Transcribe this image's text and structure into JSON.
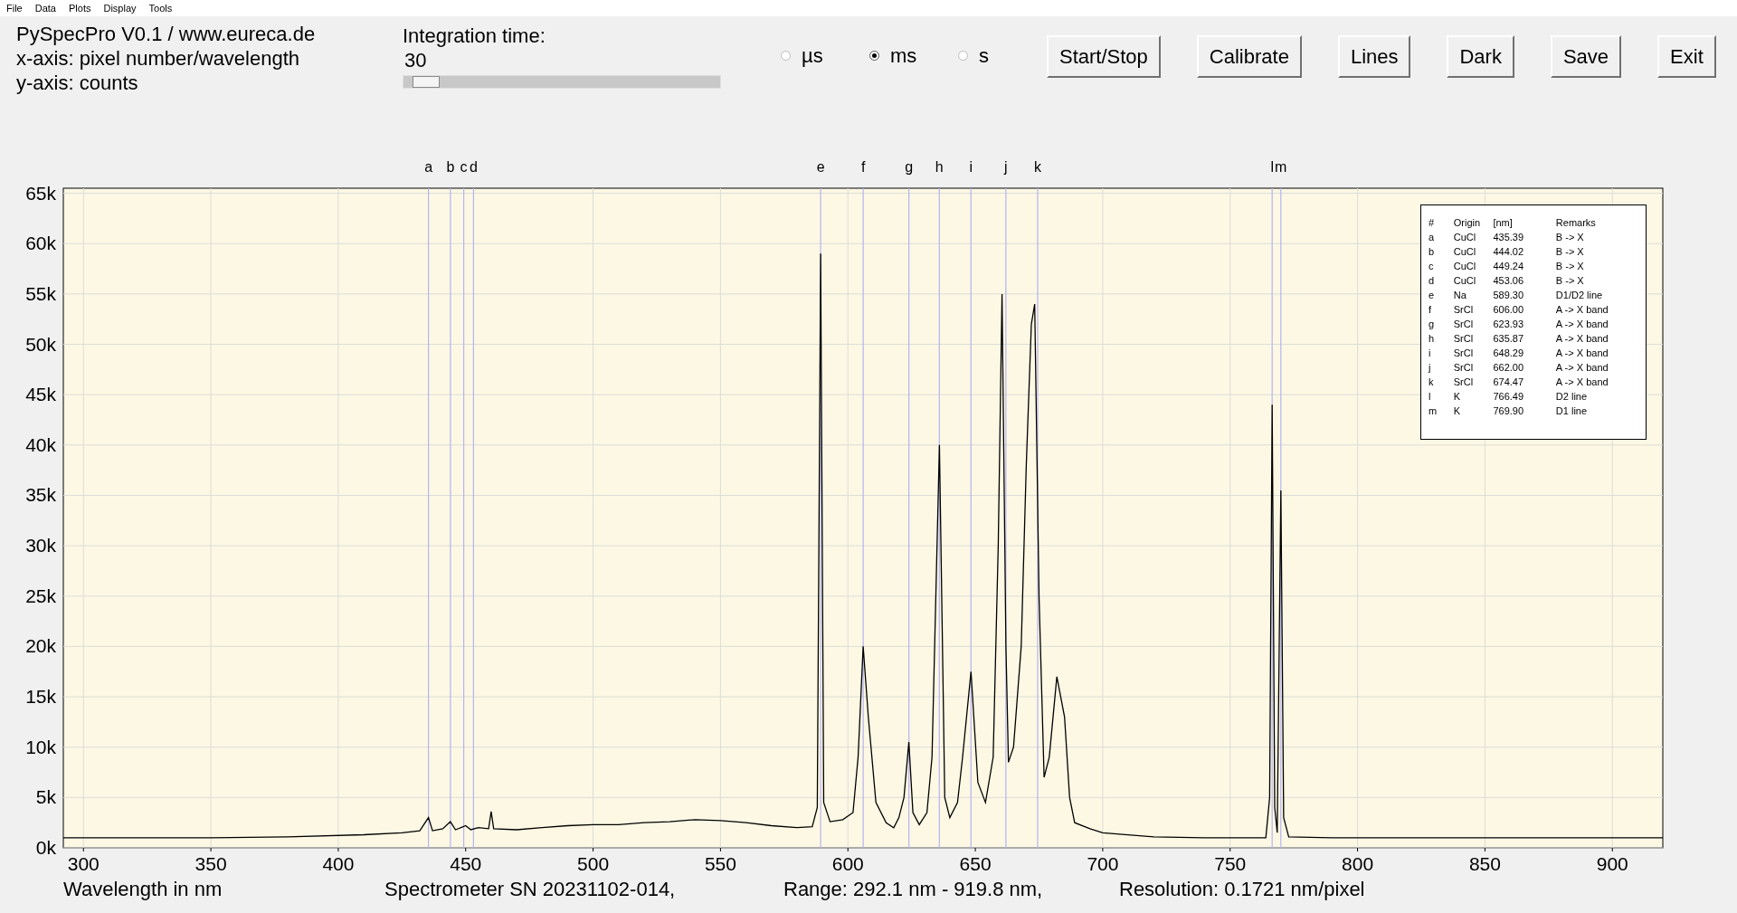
{
  "menu": [
    "File",
    "Data",
    "Plots",
    "Display",
    "Tools"
  ],
  "info": [
    "PySpecPro V0.1 / www.eureca.de",
    "x-axis: pixel number/wavelength",
    "y-axis: counts"
  ],
  "integration": {
    "label": "Integration time:",
    "value": "30",
    "level": 0.03
  },
  "units": [
    {
      "label": "µs",
      "selected": false
    },
    {
      "label": "ms",
      "selected": true
    },
    {
      "label": "s",
      "selected": false
    }
  ],
  "buttons": [
    "Start/Stop",
    "Calibrate",
    "Lines",
    "Dark",
    "Save",
    "Exit"
  ],
  "chart": {
    "chart_data": {
      "type": "line",
      "grid": true,
      "xlabel": "Wavelength in nm",
      "xlim": [
        292.1,
        919.8
      ],
      "ylim": [
        0,
        65500
      ],
      "xticks": [
        300,
        350,
        400,
        450,
        500,
        550,
        600,
        650,
        700,
        750,
        800,
        850,
        900
      ],
      "yticks": [
        {
          "value": 0,
          "label": "0k"
        },
        {
          "value": 5000,
          "label": "5k"
        },
        {
          "value": 10000,
          "label": "10k"
        },
        {
          "value": 15000,
          "label": "15k"
        },
        {
          "value": 20000,
          "label": "20k"
        },
        {
          "value": 25000,
          "label": "25k"
        },
        {
          "value": 30000,
          "label": "30k"
        },
        {
          "value": 35000,
          "label": "35k"
        },
        {
          "value": 40000,
          "label": "40k"
        },
        {
          "value": 45000,
          "label": "45k"
        },
        {
          "value": 50000,
          "label": "50k"
        },
        {
          "value": 55000,
          "label": "55k"
        },
        {
          "value": 60000,
          "label": "60k"
        },
        {
          "value": 65000,
          "label": "65k"
        }
      ],
      "x": [
        292.1,
        320,
        350,
        380,
        410,
        425,
        432,
        435.4,
        437,
        441,
        444,
        446,
        450,
        452,
        455,
        459,
        460,
        461,
        470,
        480,
        490,
        500,
        510,
        520,
        530,
        540,
        550,
        560,
        570,
        580,
        586,
        588,
        589.3,
        590.5,
        593,
        598,
        602,
        604,
        606,
        608,
        611,
        615,
        618,
        620,
        622,
        623.9,
        625.5,
        628,
        631,
        633,
        635.9,
        638,
        640,
        643,
        645,
        648.3,
        651,
        654,
        657,
        659,
        660.5,
        662,
        663,
        665,
        668,
        670,
        672,
        673.3,
        675,
        677,
        679,
        682,
        685,
        687,
        689,
        695,
        700,
        720,
        740,
        760,
        764,
        765.5,
        766.5,
        767.5,
        768.5,
        769.9,
        771,
        773,
        790,
        820,
        850,
        880,
        919.8
      ],
      "series": [
        {
          "color": "#000000",
          "values": [
            1000,
            1000,
            1000,
            1100,
            1300,
            1500,
            1700,
            3000,
            1700,
            1900,
            2600,
            1800,
            2200,
            1800,
            2000,
            1900,
            3600,
            1900,
            1800,
            2000,
            2200,
            2300,
            2300,
            2500,
            2600,
            2800,
            2700,
            2500,
            2200,
            2000,
            2100,
            4000,
            59000,
            4500,
            2600,
            2800,
            3500,
            9000,
            20000,
            13000,
            4500,
            2500,
            2000,
            3000,
            5000,
            10500,
            3500,
            2300,
            3500,
            9000,
            40000,
            5000,
            3000,
            4500,
            9000,
            17500,
            6500,
            4500,
            9000,
            30000,
            55000,
            20000,
            8500,
            10000,
            20000,
            38000,
            52000,
            54000,
            25000,
            7000,
            9000,
            17000,
            13000,
            5000,
            2500,
            1900,
            1500,
            1100,
            1000,
            1000,
            1000,
            5000,
            44000,
            4000,
            1500,
            35500,
            3000,
            1100,
            1000,
            1000,
            1000,
            1000,
            1000
          ]
        }
      ],
      "ref_lines": [
        {
          "axis": "x",
          "value": 435.39,
          "label": "a"
        },
        {
          "axis": "x",
          "value": 444.02,
          "label": "b"
        },
        {
          "axis": "x",
          "value": 449.24,
          "label": "c"
        },
        {
          "axis": "x",
          "value": 453.06,
          "label": "d"
        },
        {
          "axis": "x",
          "value": 589.3,
          "label": "e"
        },
        {
          "axis": "x",
          "value": 606.0,
          "label": "f"
        },
        {
          "axis": "x",
          "value": 623.93,
          "label": "g"
        },
        {
          "axis": "x",
          "value": 635.87,
          "label": "h"
        },
        {
          "axis": "x",
          "value": 648.29,
          "label": "i"
        },
        {
          "axis": "x",
          "value": 662.0,
          "label": "j"
        },
        {
          "axis": "x",
          "value": 674.47,
          "label": "k"
        },
        {
          "axis": "x",
          "value": 766.49,
          "label": "l"
        },
        {
          "axis": "x",
          "value": 769.9,
          "label": "m"
        }
      ]
    }
  },
  "legend": {
    "columns": [
      "#",
      "Origin",
      "[nm]",
      "Remarks"
    ],
    "rows": [
      [
        "a",
        "CuCl",
        "435.39",
        "B -> X"
      ],
      [
        "b",
        "CuCl",
        "444.02",
        "B -> X"
      ],
      [
        "c",
        "CuCl",
        "449.24",
        "B -> X"
      ],
      [
        "d",
        "CuCl",
        "453.06",
        "B -> X"
      ],
      [
        "e",
        "Na",
        "589.30",
        "D1/D2 line"
      ],
      [
        "f",
        "SrCl",
        "606.00",
        "A -> X band"
      ],
      [
        "g",
        "SrCl",
        "623.93",
        "A -> X band"
      ],
      [
        "h",
        "SrCl",
        "635.87",
        "A -> X band"
      ],
      [
        "i",
        "SrCl",
        "648.29",
        "A -> X band"
      ],
      [
        "j",
        "SrCl",
        "662.00",
        "A -> X band"
      ],
      [
        "k",
        "SrCl",
        "674.47",
        "A -> X band"
      ],
      [
        "l",
        "K",
        "766.49",
        "D2 line"
      ],
      [
        "m",
        "K",
        "769.90",
        "D1 line"
      ]
    ]
  },
  "status": [
    "Spectrometer SN 20231102-014,",
    "Range: 292.1 nm - 919.8 nm,",
    "Resolution: 0.1721 nm/pixel"
  ]
}
